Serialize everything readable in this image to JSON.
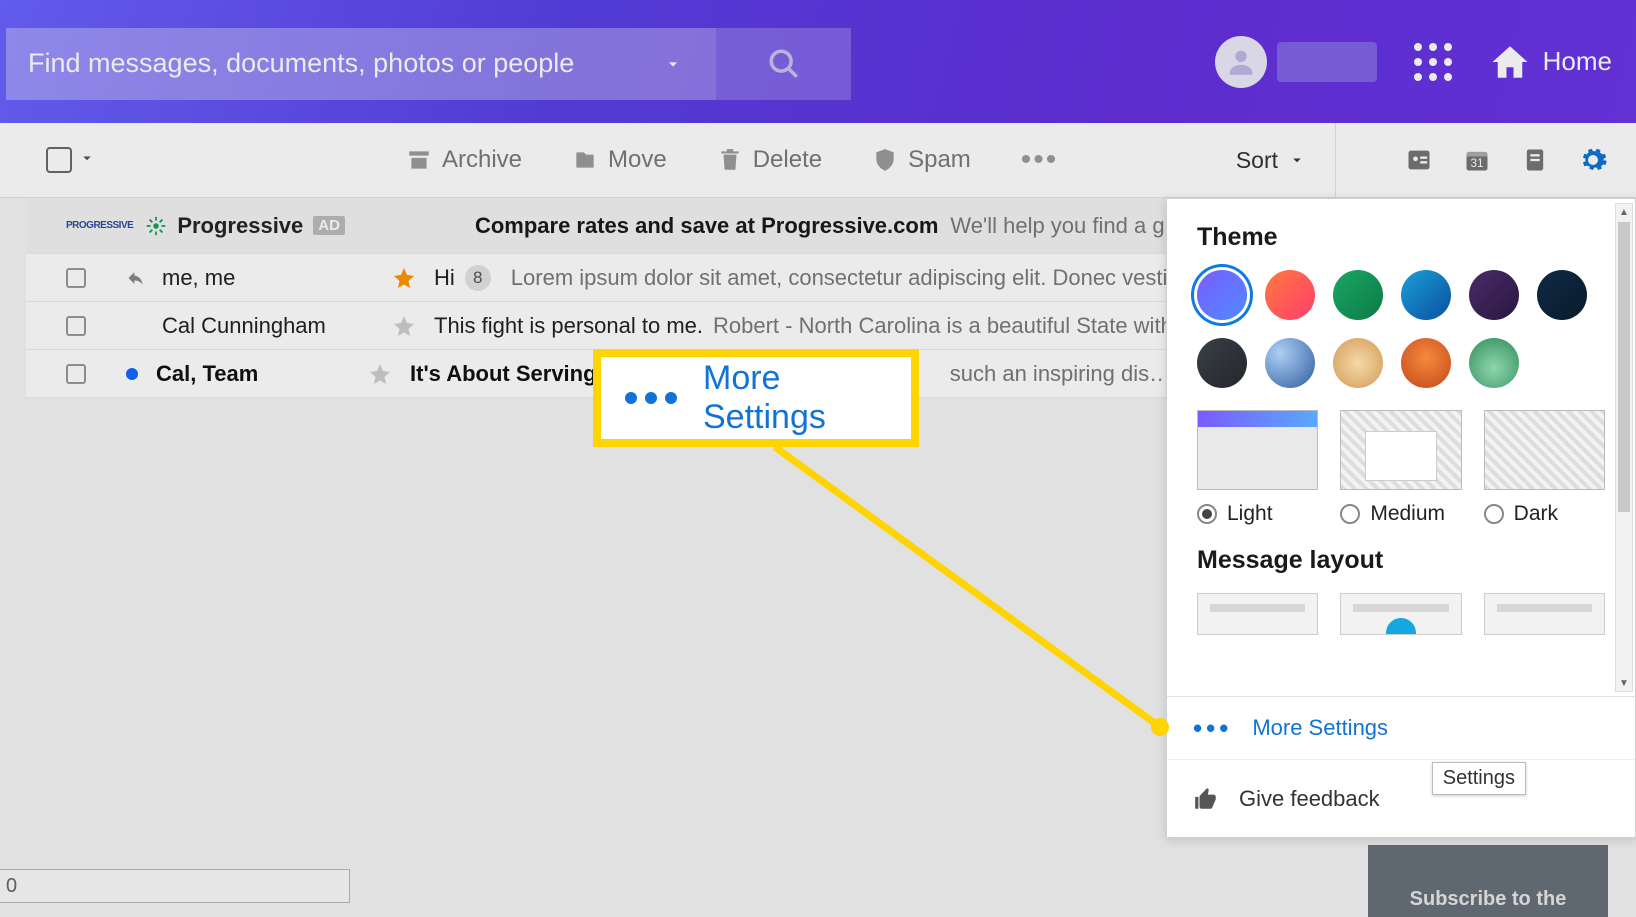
{
  "search": {
    "placeholder": "Find messages, documents, photos or people"
  },
  "header": {
    "home": "Home"
  },
  "toolbar": {
    "archive": "Archive",
    "move": "Move",
    "delete": "Delete",
    "spam": "Spam",
    "sort": "Sort"
  },
  "ad": {
    "provider_small": "PROGRESSIVE",
    "provider": "Progressive",
    "badge": "AD",
    "subject": "Compare rates and save at Progressive.com",
    "snippet": "We'll help you find a great rate. Even"
  },
  "messages": [
    {
      "sender": "me, me",
      "starred": true,
      "unread": false,
      "reply": true,
      "subject": "Hi",
      "count": "8",
      "snippet": "Lorem ipsum dolor sit amet, consectetur adipiscing elit. Donec vestibul…"
    },
    {
      "sender": "Cal Cunningham",
      "starred": false,
      "unread": false,
      "reply": false,
      "subject": "This fight is personal to me.",
      "count": "",
      "snippet": "Robert - North Carolina is a beautiful State with a …"
    },
    {
      "sender": "Cal, Team",
      "starred": false,
      "unread": true,
      "reply": false,
      "dot": true,
      "subject": "It's About Serving O",
      "count": "",
      "snippet": "such an inspiring dis…"
    }
  ],
  "panel": {
    "theme_heading": "Theme",
    "modes": {
      "light": "Light",
      "medium": "Medium",
      "dark": "Dark"
    },
    "layout_heading": "Message layout",
    "more_settings": "More Settings",
    "feedback": "Give feedback",
    "swatches": [
      "linear-gradient(135deg,#7a5cff,#4f8bff)",
      "linear-gradient(135deg,#ff7a3d,#ff3d6e)",
      "linear-gradient(135deg,#1aa765,#0c7a46)",
      "linear-gradient(135deg,#1aa0d6,#0b4f9e)",
      "linear-gradient(135deg,#4a2b66,#2a1740)",
      "linear-gradient(135deg,#0f2a44,#0a1a2b)",
      "linear-gradient(135deg,#3a3f46,#23272c)",
      "radial-gradient(circle at 30% 30%,#aecff5,#2e5e9e)",
      "radial-gradient(circle at 50% 50%,#f5d9a8,#d49a55)",
      "radial-gradient(circle at 50% 40%,#f58a3d,#c4471b)",
      "radial-gradient(circle at 50% 60%,#8fd6b0,#2e8b57)"
    ]
  },
  "callout": {
    "text": "More Settings"
  },
  "tooltip": "Settings",
  "sub_banner": "Subscribe to the",
  "bottom_info": "0"
}
